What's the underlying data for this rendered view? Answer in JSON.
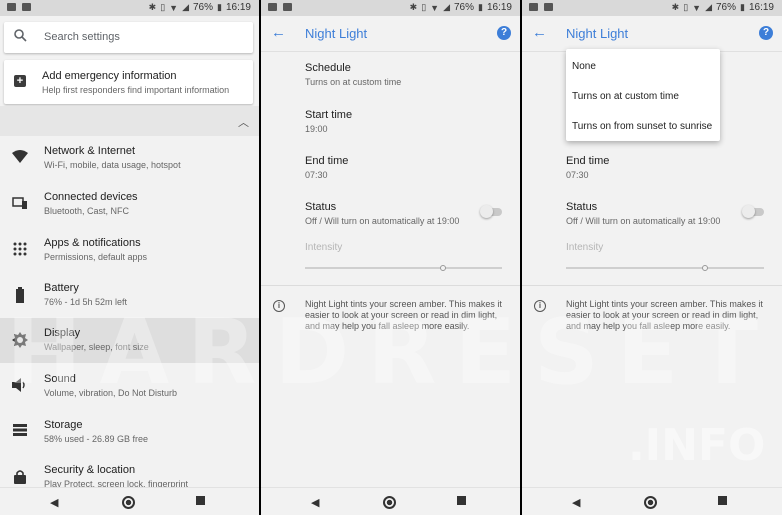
{
  "status": {
    "battery": "76%",
    "time": "16:19"
  },
  "settings": {
    "search_placeholder": "Search settings",
    "emergency": {
      "title": "Add emergency information",
      "subtitle": "Help first responders find important information"
    },
    "items": [
      {
        "title": "Network & Internet",
        "subtitle": "Wi-Fi, mobile, data usage, hotspot",
        "icon": "wifi-icon"
      },
      {
        "title": "Connected devices",
        "subtitle": "Bluetooth, Cast, NFC",
        "icon": "devices-icon"
      },
      {
        "title": "Apps & notifications",
        "subtitle": "Permissions, default apps",
        "icon": "apps-icon"
      },
      {
        "title": "Battery",
        "subtitle": "76% - 1d 5h 52m left",
        "icon": "battery-icon"
      },
      {
        "title": "Display",
        "subtitle": "Wallpaper, sleep, font size",
        "icon": "brightness-icon"
      },
      {
        "title": "Sound",
        "subtitle": "Volume, vibration, Do Not Disturb",
        "icon": "volume-icon"
      },
      {
        "title": "Storage",
        "subtitle": "58% used - 26.89 GB free",
        "icon": "storage-icon"
      },
      {
        "title": "Security & location",
        "subtitle": "Play Protect, screen lock, fingerprint",
        "icon": "lock-icon"
      }
    ]
  },
  "night_light": {
    "title": "Night Light",
    "schedule": {
      "title": "Schedule",
      "subtitle": "Turns on at custom time"
    },
    "start": {
      "title": "Start time",
      "subtitle": "19:00"
    },
    "end": {
      "title": "End time",
      "subtitle": "07:30"
    },
    "status": {
      "title": "Status",
      "subtitle": "Off / Will turn on automatically at 19:00",
      "on": false
    },
    "intensity_label": "Intensity",
    "intensity_value": 0.7,
    "info": "Night Light tints your screen amber. This makes it easier to look at your screen or read in dim light, and may help you fall asleep more easily.",
    "dropdown": [
      "None",
      "Turns on at custom time",
      "Turns on from sunset to sunrise"
    ]
  },
  "watermark": {
    "main": "HARDRESET",
    "sub": ".INFO"
  },
  "colors": {
    "accent": "#3d7ed8"
  }
}
